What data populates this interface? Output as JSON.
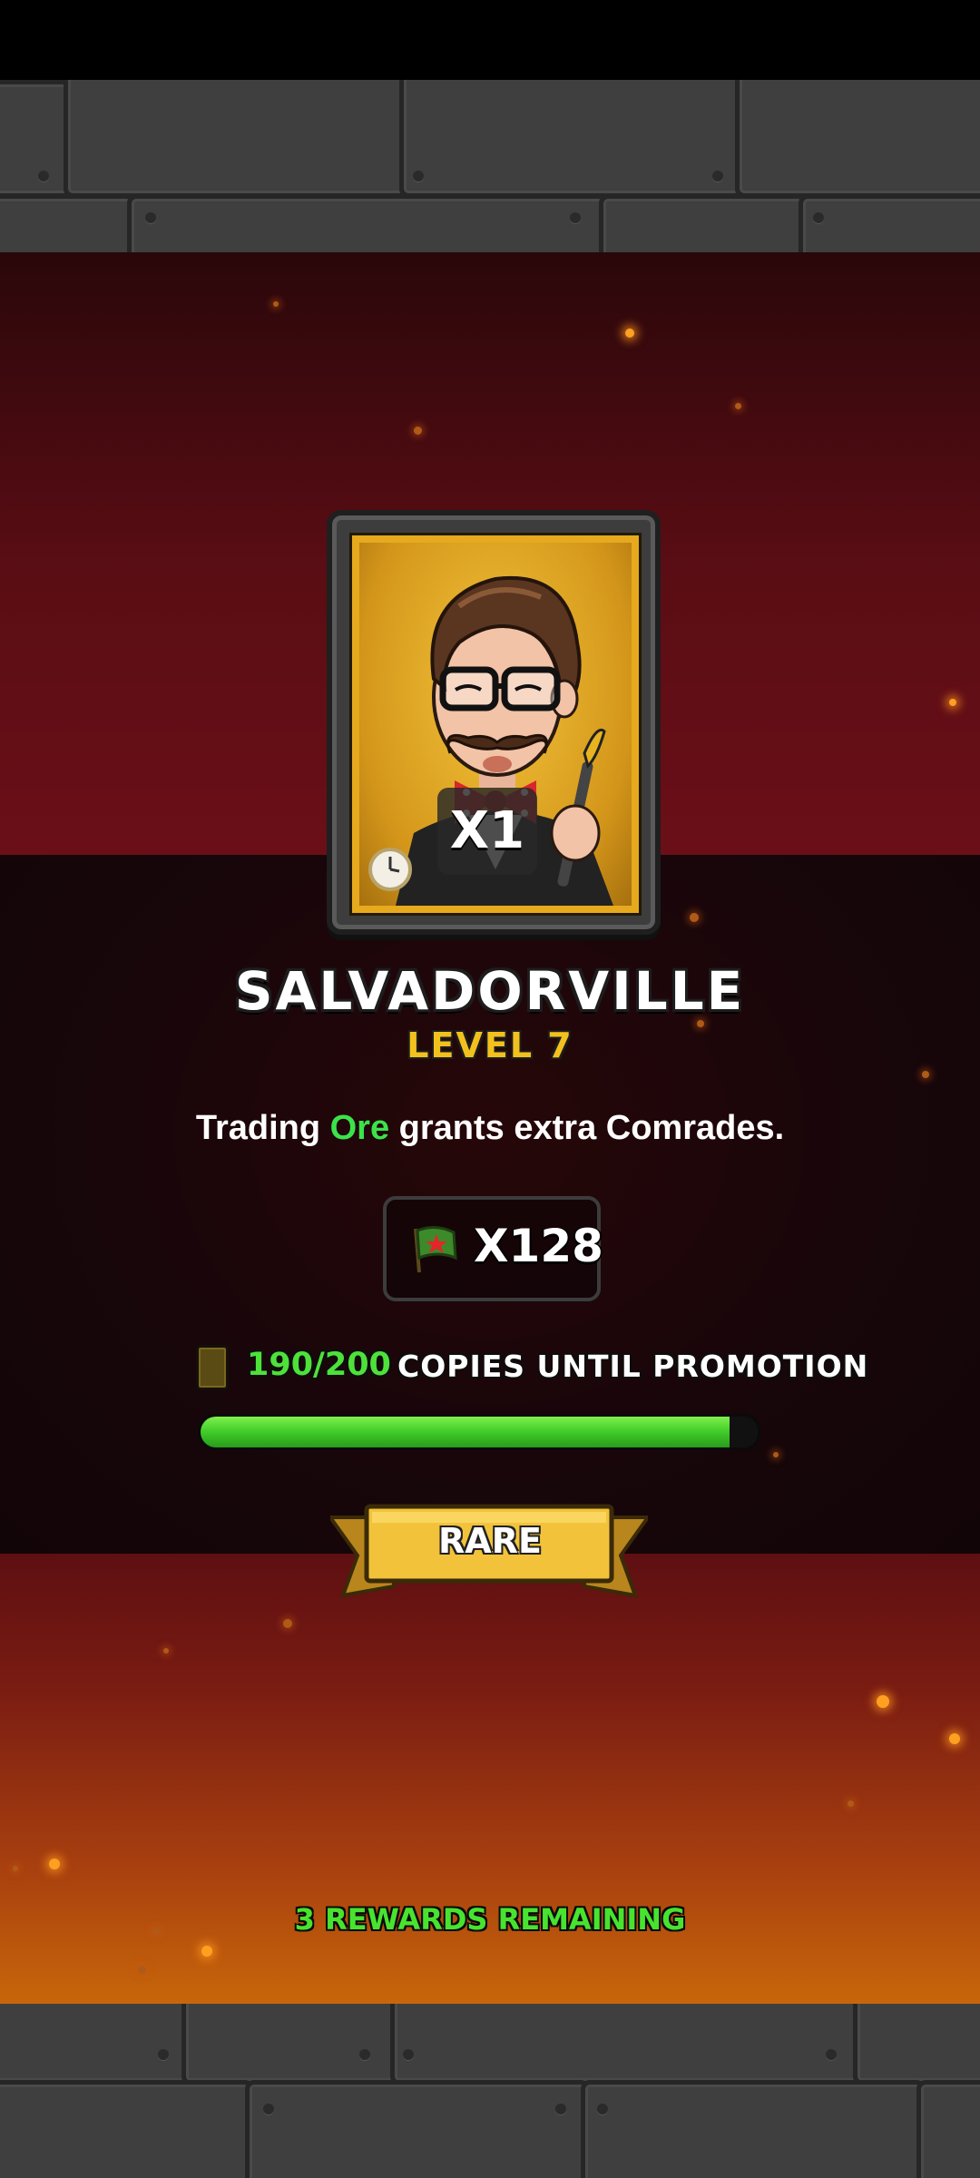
{
  "card": {
    "quantity_label": "X1",
    "hero_name": "SALVADORVILLE",
    "level_label": "LEVEL 7"
  },
  "ability": {
    "prefix": "Trading",
    "highlight": "Ore",
    "suffix": "grants extra Comrades."
  },
  "reward": {
    "icon": "red-star-flag-icon",
    "count_label": "X128"
  },
  "promotion": {
    "count_label": "190/200",
    "label": "COPIES UNTIL PROMOTION",
    "progress_fraction": 0.95
  },
  "rarity": {
    "label": "RARE"
  },
  "footer": {
    "remaining_label": "3 REWARDS REMAINING"
  },
  "colors": {
    "highlight_green": "#3be34a",
    "level_gold": "#f2c11d",
    "rarity_gold": "#f2c33a"
  }
}
